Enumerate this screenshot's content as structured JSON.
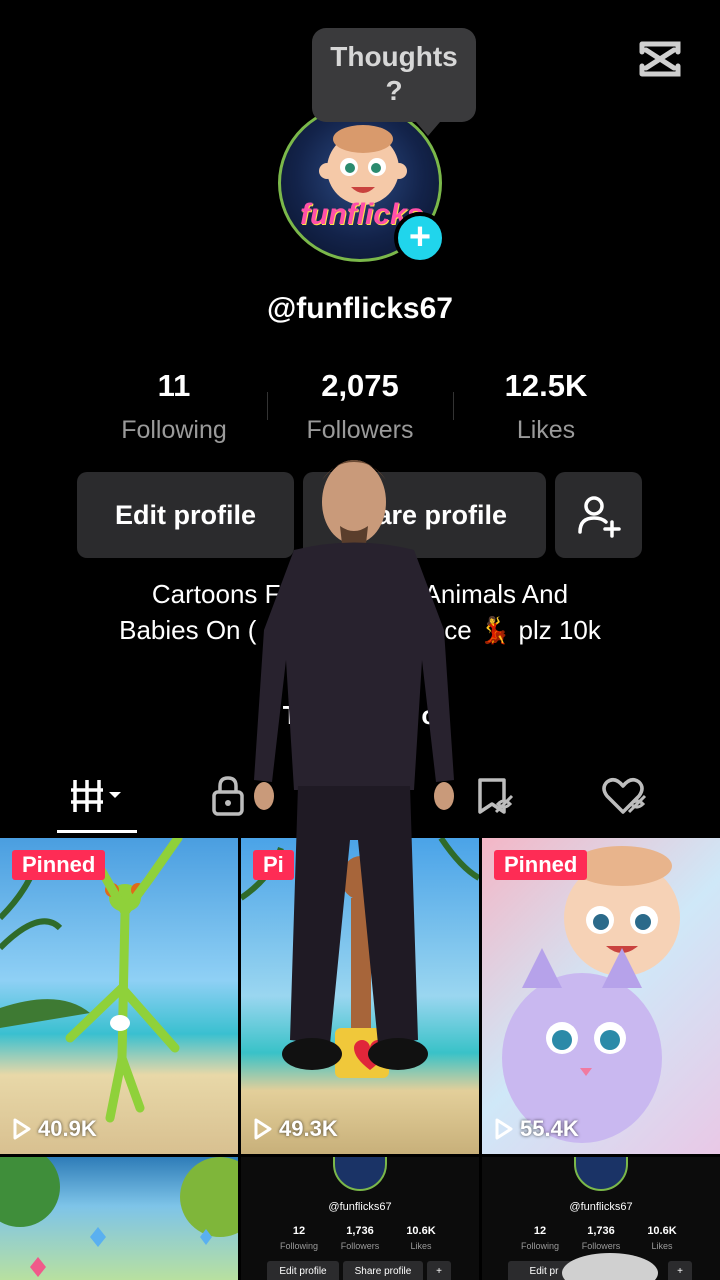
{
  "popup": {
    "text_line1": "Thoughts",
    "text_line2": "?"
  },
  "profile": {
    "avatar_text": "funflicks",
    "username": "@funflicks67",
    "stats": [
      {
        "value": "11",
        "label": "Following"
      },
      {
        "value": "2,075",
        "label": "Followers"
      },
      {
        "value": "12.5K",
        "label": "Likes"
      }
    ],
    "buttons": {
      "edit": "Edit profile",
      "share": "Share profile"
    },
    "bio_line1": "Cartoons F                    Animals And",
    "bio_line2": "Babies On (                          ce 💃 plz 10k",
    "link_text": "T                 o"
  },
  "videos": [
    {
      "pinned": "Pinned",
      "views": "40.9K"
    },
    {
      "pinned": "Pi",
      "views": "49.3K"
    },
    {
      "pinned": "Pinned",
      "views": "55.4K"
    }
  ],
  "mini_profile": {
    "username": "@funflicks67",
    "following": "12",
    "following_label": "Following",
    "followers": "1,736",
    "followers_label": "Followers",
    "likes": "10.6K",
    "likes_label": "Likes",
    "edit": "Edit profile",
    "share": "Share profile",
    "edit_cut": "Edit pr"
  },
  "colors": {
    "accent_pink": "#fe2c55",
    "accent_cyan": "#20d5ec"
  }
}
